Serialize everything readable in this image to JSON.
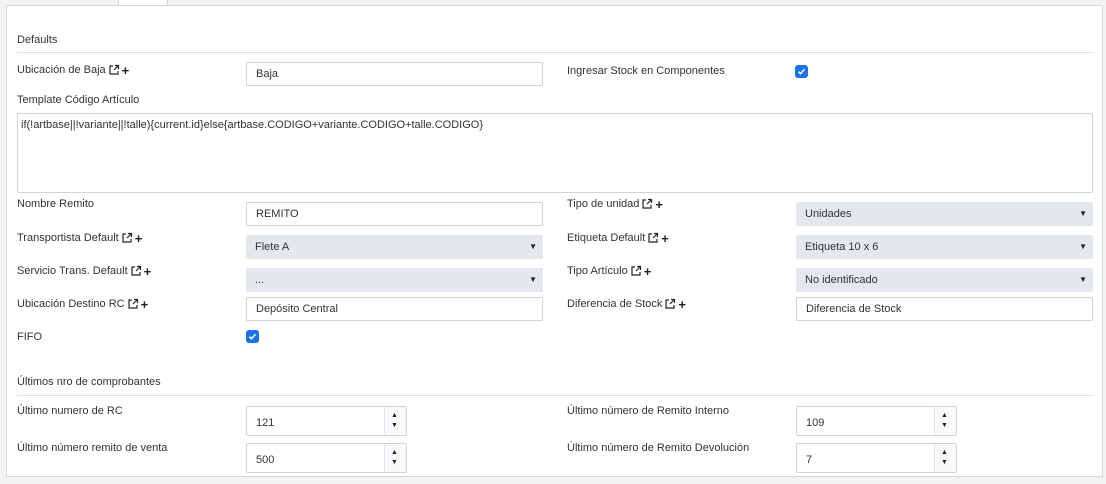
{
  "defaults": {
    "title": "Defaults",
    "ubicacion_baja": {
      "label": "Ubicación de Baja",
      "value": "Baja"
    },
    "ingresar_stock": {
      "label": "Ingresar Stock en Componentes",
      "checked": true
    },
    "template": {
      "label": "Template Código Artículo",
      "value": "if(!artbase||!variante||!talle){current.id}else{artbase.CODIGO+variante.CODIGO+talle.CODIGO}"
    },
    "nombre_remito": {
      "label": "Nombre Remito",
      "value": "REMITO"
    },
    "tipo_unidad": {
      "label": "Tipo de unidad",
      "value": "Unidades"
    },
    "transportista": {
      "label": "Transportista Default",
      "value": "Flete A"
    },
    "etiqueta": {
      "label": "Etiqueta Default",
      "value": "Etiqueta 10 x 6"
    },
    "servicio_trans": {
      "label": "Servicio Trans. Default",
      "value": "..."
    },
    "tipo_articulo": {
      "label": "Tipo Artículo",
      "value": "No identificado"
    },
    "ubicacion_destino": {
      "label": "Ubicación Destino RC",
      "value": "Depósito Central"
    },
    "diferencia_stock": {
      "label": "Diferencia de Stock",
      "value": "Diferencia de Stock"
    },
    "fifo": {
      "label": "FIFO",
      "checked": true
    }
  },
  "comprobantes": {
    "title": "Últimos nro de comprobantes",
    "ultimo_rc": {
      "label": "Último numero de RC",
      "value": "121"
    },
    "ultimo_remito_interno": {
      "label": "Último número de Remito Interno",
      "value": "109"
    },
    "ultimo_remito_venta": {
      "label": "Último número remito de venta",
      "value": "500"
    },
    "ultimo_remito_devolucion": {
      "label": "Último número de Remito Devolución",
      "value": "7"
    }
  },
  "colors": {
    "accent": "#1a73e8",
    "select_bg": "#e4e7ec",
    "border": "#ced4da"
  },
  "icons": {
    "external": "external-link-icon",
    "add": "plus-icon",
    "check": "check-icon"
  }
}
